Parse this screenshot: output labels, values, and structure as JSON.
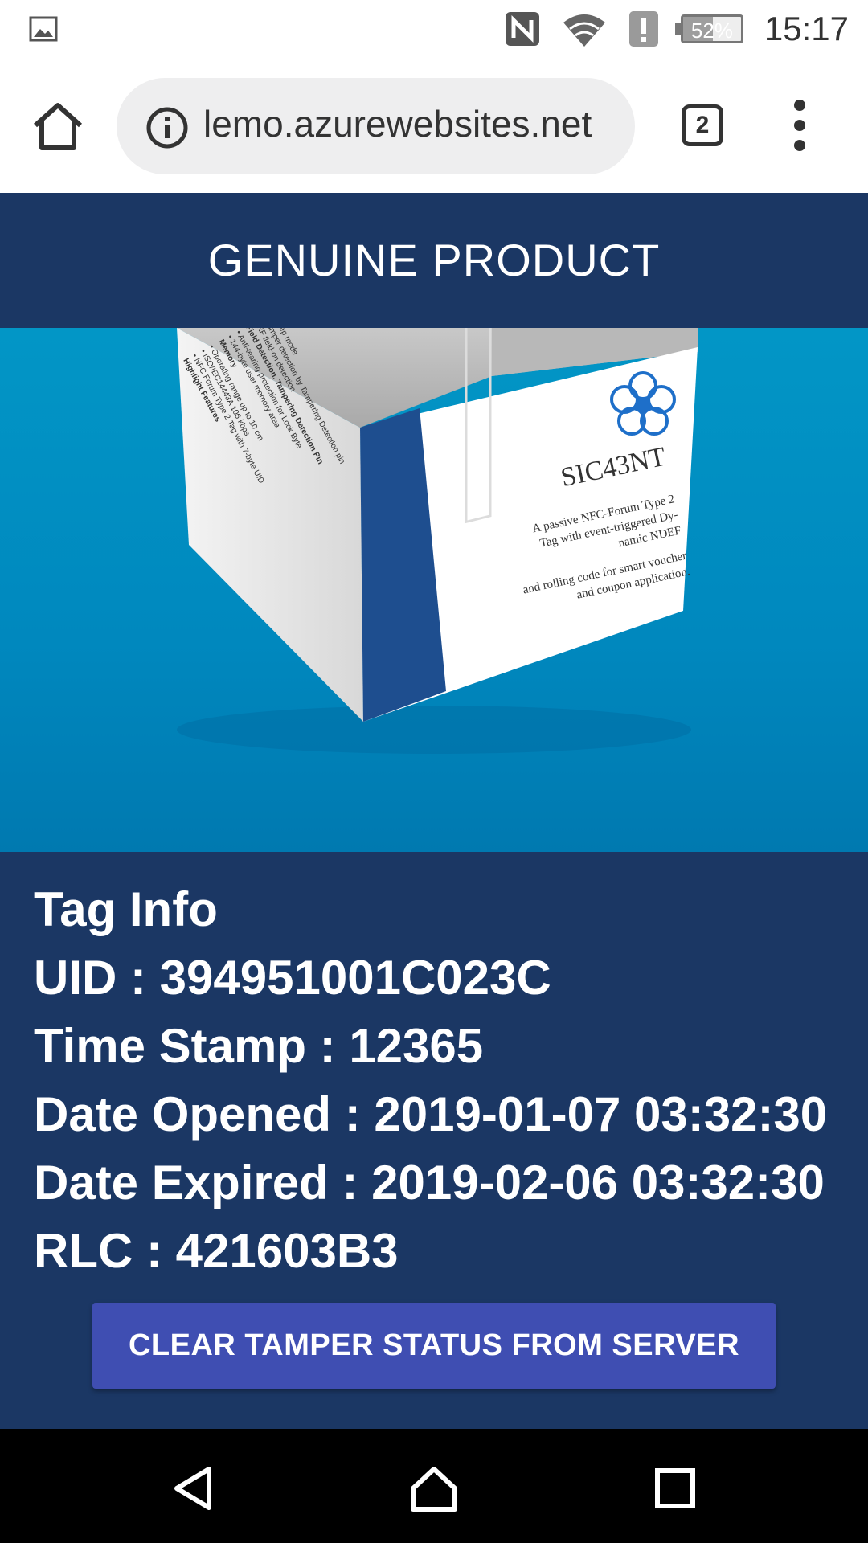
{
  "status_bar": {
    "time": "15:17",
    "battery_percent": "52%",
    "battery_level": 0.52,
    "icons": [
      "gallery-icon",
      "nfc-icon",
      "wifi-icon",
      "alert-icon",
      "battery-icon"
    ]
  },
  "browser": {
    "url": "lemo.azurewebsites.net",
    "tab_count": "2",
    "icons": [
      "home-icon",
      "info-icon",
      "tabs-icon",
      "overflow-menu-icon"
    ]
  },
  "header": {
    "title": "GENUINE PRODUCT"
  },
  "product_image": {
    "brand": "SIC43NT",
    "front_lines": [
      "A passive NFC-Forum Type 2",
      "Tag with event-triggered Dy-",
      "namic NDEF",
      "and rolling code for smart voucher",
      "and coupon application."
    ],
    "side_lines": [
      "Highlight Features",
      "• NFC Forum Type 2 Tag with 7-byte UID",
      "• ISO/IEC14443A 106 kbps",
      "• Operating range up to 10 cm",
      "Memory",
      "• 144-byte user memory area",
      "• Anti-tearing protection for Lock Byte",
      "Field Detection, Tampering Detection Pin",
      "• RF field-on detection",
      "• Tamper detection by Tampering Detection pin",
      "• Sleep mode"
    ]
  },
  "tag_info": {
    "heading": "Tag Info",
    "uid": "UID : 394951001C023C",
    "time_stamp": "Time Stamp : 12365",
    "date_opened": "Date Opened : 2019-01-07 03:32:30",
    "date_expired": "Date Expired : 2019-02-06 03:32:30",
    "rlc": "RLC : 421603B3"
  },
  "actions": {
    "clear_label": "CLEAR TAMPER STATUS FROM SERVER"
  },
  "colors": {
    "header_bg": "#1b3764",
    "button_bg": "#3f4eb2",
    "hero_bg": "#0290c3"
  }
}
